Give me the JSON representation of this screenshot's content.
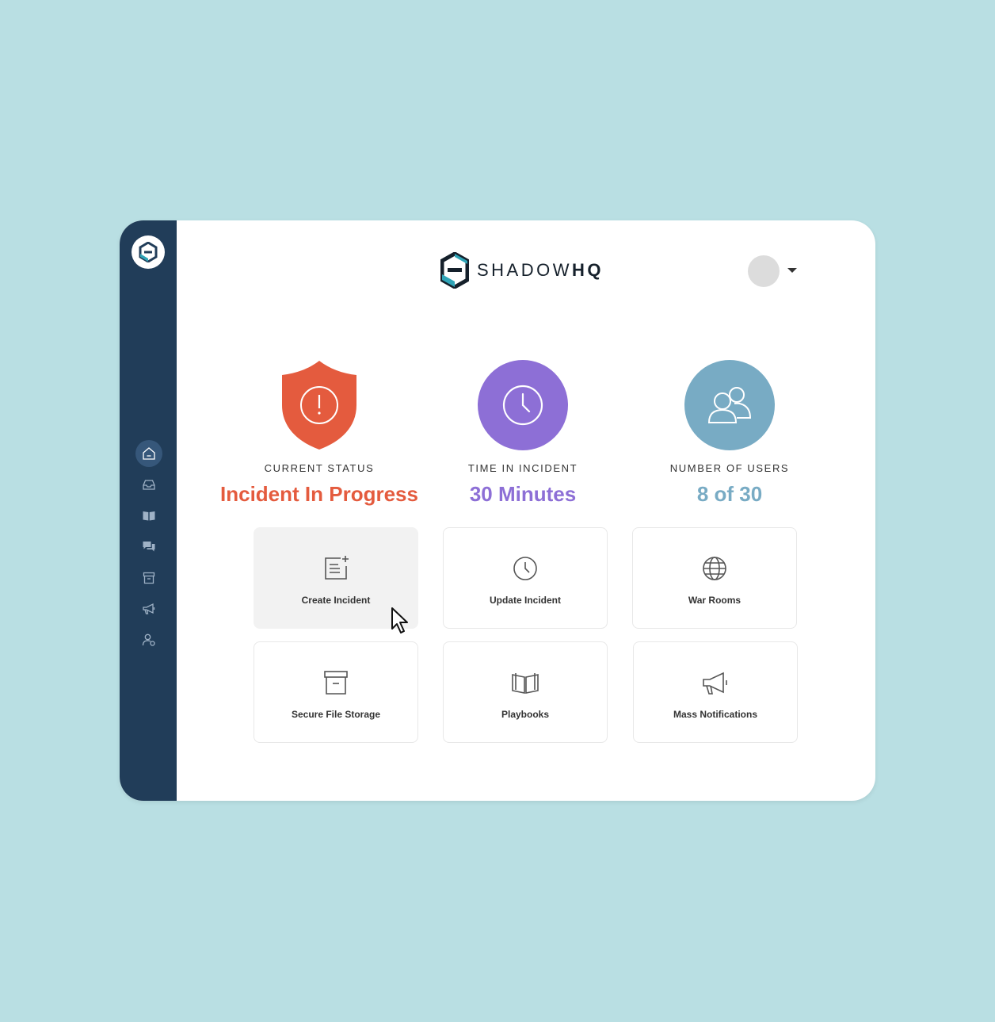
{
  "colors": {
    "background": "#b9dfe3",
    "sidebar": "#213d59",
    "status": "#e45b3e",
    "time": "#8d6fd6",
    "users": "#78abc4"
  },
  "brand": {
    "name_light": "SHADOW",
    "name_bold": "HQ",
    "logo_icon": "shadowhq-hexagon-logo"
  },
  "header": {
    "avatar": "user-avatar",
    "menu_icon": "caret-down-icon"
  },
  "sidebar": {
    "items": [
      {
        "name": "home",
        "icon": "home-icon",
        "active": true
      },
      {
        "name": "inbox",
        "icon": "inbox-icon",
        "active": false
      },
      {
        "name": "playbooks",
        "icon": "book-icon",
        "active": false
      },
      {
        "name": "chat",
        "icon": "chat-icon",
        "active": false
      },
      {
        "name": "archive",
        "icon": "archive-icon",
        "active": false
      },
      {
        "name": "notifications",
        "icon": "megaphone-icon",
        "active": false
      },
      {
        "name": "users",
        "icon": "user-settings-icon",
        "active": false
      }
    ]
  },
  "stats": [
    {
      "label": "CURRENT STATUS",
      "value": "Incident In Progress",
      "icon": "shield-alert-icon",
      "color": "#e45b3e"
    },
    {
      "label": "TIME IN INCIDENT",
      "value": "30 Minutes",
      "icon": "clock-icon",
      "color": "#8d6fd6"
    },
    {
      "label": "NUMBER OF USERS",
      "value": "8 of 30",
      "icon": "users-icon",
      "color": "#78abc4"
    }
  ],
  "actions": [
    {
      "label": "Create Incident",
      "icon": "create-note-icon"
    },
    {
      "label": "Update Incident",
      "icon": "clock-icon"
    },
    {
      "label": "War Rooms",
      "icon": "globe-icon"
    },
    {
      "label": "Secure File Storage",
      "icon": "archive-box-icon"
    },
    {
      "label": "Playbooks",
      "icon": "open-book-icon"
    },
    {
      "label": "Mass Notifications",
      "icon": "megaphone-icon"
    }
  ]
}
